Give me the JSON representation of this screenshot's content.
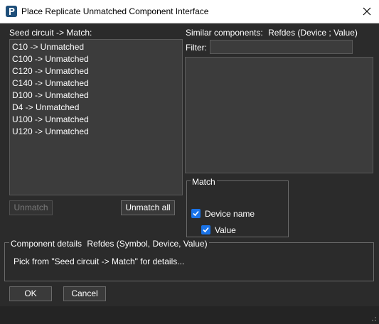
{
  "window": {
    "title": "Place Replicate Unmatched Component Interface",
    "icon": "p-app-icon",
    "close_icon": "close-icon"
  },
  "seed": {
    "label": "Seed circuit -> Match:",
    "items": [
      "C10 -> Unmatched",
      "C100 -> Unmatched",
      "C120 -> Unmatched",
      "C140 -> Unmatched",
      "D100 -> Unmatched",
      "D4 -> Unmatched",
      "U100 -> Unmatched",
      "U120 -> Unmatched"
    ],
    "unmatch_label": "Unmatch",
    "unmatch_all_label": "Unmatch all"
  },
  "similar": {
    "label": "Similar components:",
    "columns": "Refdes  (Device ; Value)",
    "filter_label": "Filter:",
    "filter_value": ""
  },
  "match": {
    "title": "Match",
    "device_name": {
      "label": "Device name",
      "checked": true
    },
    "value": {
      "label": "Value",
      "checked": true
    }
  },
  "details": {
    "title": "Component details",
    "columns": "Refdes (Symbol, Device, Value)",
    "hint": "Pick from \"Seed circuit -> Match\" for details..."
  },
  "footer": {
    "ok_label": "OK",
    "cancel_label": "Cancel"
  },
  "colors": {
    "background": "#2b2b2b",
    "field": "#3c3c3c",
    "checkbox_accent": "#1a73e8"
  }
}
